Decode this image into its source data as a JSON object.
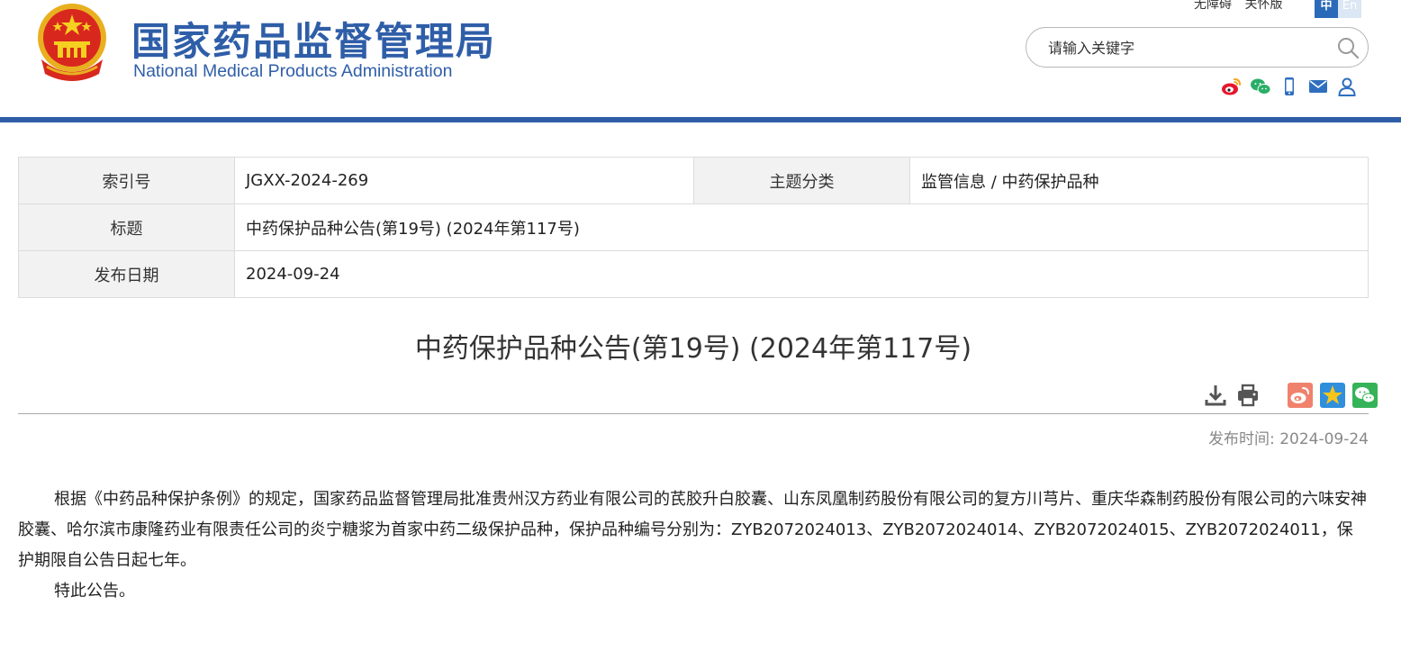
{
  "header": {
    "site_name_cn": "国家药品监督管理局",
    "site_name_en": "National Medical Products Administration",
    "accessibility_link": "无障碍",
    "care_link": "关怀版",
    "lang_zh": "中",
    "lang_en": "En",
    "search_placeholder": "请输入关键字",
    "brand_color": "#2f5ea8",
    "social_icons": [
      "weibo-icon",
      "wechat-icon",
      "mobile-icon",
      "mail-icon",
      "user-icon"
    ]
  },
  "info_table": {
    "index_label": "索引号",
    "index_value": "JGXX-2024-269",
    "category_label": "主题分类",
    "category_value": "监管信息 / 中药保护品种",
    "title_label": "标题",
    "title_value": "中药保护品种公告(第19号) (2024年第117号)",
    "date_label": "发布日期",
    "date_value": "2024-09-24"
  },
  "article": {
    "title": "中药保护品种公告(第19号) (2024年第117号)",
    "publish_label": "发布时间:",
    "publish_date": "2024-09-24",
    "tool_icons": [
      "download-icon",
      "print-icon",
      "weibo-share-icon",
      "qzone-share-icon",
      "wechat-share-icon"
    ],
    "paragraphs": [
      "根据《中药品种保护条例》的规定，国家药品监督管理局批准贵州汉方药业有限公司的芪胶升白胶囊、山东凤凰制药股份有限公司的复方川芎片、重庆华森制药股份有限公司的六味安神胶囊、哈尔滨市康隆药业有限责任公司的炎宁糖浆为首家中药二级保护品种，保护品种编号分别为：ZYB2072024013、ZYB2072024014、ZYB2072024015、ZYB2072024011，保护期限自公告日起七年。",
      "特此公告。"
    ]
  }
}
